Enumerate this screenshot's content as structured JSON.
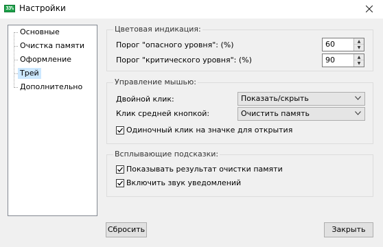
{
  "window": {
    "title": "Настройки",
    "icon": "app-icon",
    "icon_text": "33%"
  },
  "nav": {
    "items": [
      {
        "label": "Основные",
        "selected": false
      },
      {
        "label": "Очистка памяти",
        "selected": false
      },
      {
        "label": "Оформление",
        "selected": false
      },
      {
        "label": "Трей",
        "selected": true
      },
      {
        "label": "Дополнительно",
        "selected": false
      }
    ]
  },
  "color_indication": {
    "title": "Цветовая индикация:",
    "danger_label": "Порог \"опасного уровня\": (%)",
    "danger_value": "60",
    "critical_label": "Порог \"критического уровня\": (%)",
    "critical_value": "90"
  },
  "mouse": {
    "title": "Управление мышью:",
    "double_click_label": "Двойной клик:",
    "double_click_value": "Показать/скрыть",
    "middle_click_label": "Клик средней кнопкой:",
    "middle_click_value": "Очистить память",
    "single_click_label": "Одиночный клик на значке для открытия",
    "single_click_checked": true
  },
  "popups": {
    "title": "Всплывающие подсказки:",
    "show_result_label": "Показывать результат очистки памяти",
    "show_result_checked": true,
    "sound_label": "Включить звук уведомлений",
    "sound_checked": true
  },
  "footer": {
    "reset_label": "Сбросить",
    "close_label": "Закрыть"
  }
}
